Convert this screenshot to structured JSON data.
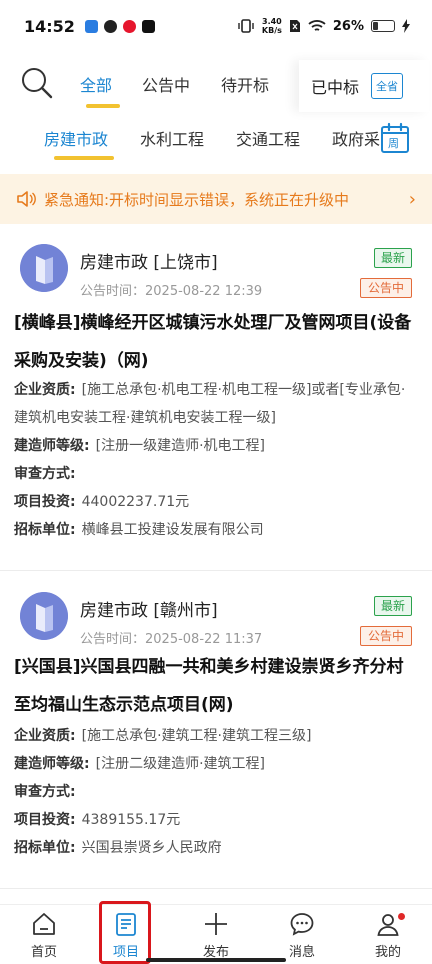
{
  "status_bar": {
    "time": "14:52",
    "net_speed_value": "3.40",
    "net_speed_unit": "KB/s",
    "battery": "26%"
  },
  "top_tabs": {
    "items": [
      "全部",
      "公告中",
      "待开标",
      "已中标"
    ],
    "province_label": "全省"
  },
  "category_tabs": {
    "items": [
      "房建市政",
      "水利工程",
      "交通工程",
      "政府采"
    ],
    "calendar_label": "周"
  },
  "notice": {
    "text": "紧急通知:开标时间显示错误，系统正在升级中"
  },
  "cards": [
    {
      "category": "房建市政 [上饶市]",
      "time_label": "公告时间：",
      "time": "2025-08-22 12:39",
      "badge_new": "最新",
      "badge_status": "公告中",
      "title": "[横峰县]横峰经开区城镇污水处理厂及管网项目(设备采购及安装)（网)",
      "rows": [
        {
          "label": "企业资质:",
          "value": "[施工总承包·机电工程·机电工程一级]或者[专业承包·建筑机电安装工程·建筑机电安装工程一级]"
        },
        {
          "label": "建造师等级:",
          "value": "[注册一级建造师·机电工程]"
        },
        {
          "label": "审查方式:",
          "value": ""
        },
        {
          "label": "项目投资:",
          "value": "44002237.71元"
        },
        {
          "label": "招标单位:",
          "value": "横峰县工投建设发展有限公司"
        }
      ]
    },
    {
      "category": "房建市政 [赣州市]",
      "time_label": "公告时间：",
      "time": "2025-08-22 11:37",
      "badge_new": "最新",
      "badge_status": "公告中",
      "title": "[兴国县]兴国县四融一共和美乡村建设崇贤乡齐分村至均福山生态示范点项目(网)",
      "rows": [
        {
          "label": "企业资质:",
          "value": "[施工总承包·建筑工程·建筑工程三级]"
        },
        {
          "label": "建造师等级:",
          "value": "[注册二级建造师·建筑工程]"
        },
        {
          "label": "审查方式:",
          "value": ""
        },
        {
          "label": "项目投资:",
          "value": "4389155.17元"
        },
        {
          "label": "招标单位:",
          "value": "兴国县崇贤乡人民政府"
        }
      ]
    }
  ],
  "bottom_nav": {
    "items": [
      "首页",
      "项目",
      "发布",
      "消息",
      "我的"
    ]
  },
  "colors": {
    "accent": "#1c86d1",
    "underline": "#f2c230",
    "notice_text": "#e67a1c",
    "notice_bg": "#fdf3e3",
    "badge_green": "#2ba24c",
    "badge_orange": "#e36b3a",
    "highlight_red": "#d9171c"
  }
}
